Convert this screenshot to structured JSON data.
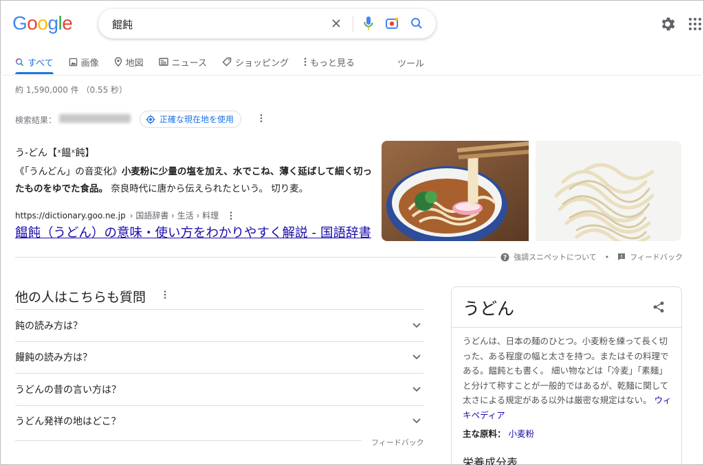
{
  "logo": {
    "letters": [
      "G",
      "o",
      "o",
      "g",
      "l",
      "e"
    ],
    "colors": [
      "#4285f4",
      "#ea4335",
      "#fbbc05",
      "#4285f4",
      "#34a853",
      "#ea4335"
    ]
  },
  "search": {
    "query": "餛飩"
  },
  "tabs": [
    {
      "label": "すべて",
      "icon": "search-icon"
    },
    {
      "label": "画像",
      "icon": "image-icon"
    },
    {
      "label": "地図",
      "icon": "map-pin-icon"
    },
    {
      "label": "ニュース",
      "icon": "news-icon"
    },
    {
      "label": "ショッピング",
      "icon": "tag-icon"
    },
    {
      "label": "もっと見る",
      "icon": "more-vert-icon"
    }
  ],
  "tools_label": "ツール",
  "stats": "約 1,590,000 件 （0.55 秒）",
  "location": {
    "label": "検索結果：",
    "button": "正確な現在地を使用"
  },
  "snippet": {
    "word": "う‐どん【ˣ饂ˣ飩】",
    "text_a": "《「うんどん」の音変化》",
    "text_b": "小麦粉に少量の塩を加え、水でこね、薄く延ばして細く切ったものをゆでた食品。",
    "text_c": " 奈良時代に唐から伝えられたという。 切り麦。",
    "url": "https://dictionary.goo.ne.jp",
    "crumbs": "› 国語辞書 › 生活 › 料理",
    "link": "饂飩（うどん）の意味・使い方をわかりやすく解説 - 国語辞書",
    "about": "強調スニペットについて",
    "sep": "•",
    "feedback": "フィードバック"
  },
  "paa": {
    "title": "他の人はこちらも質問",
    "questions": [
      "飩の読み方は？",
      "饅飩の読み方は？",
      "うどんの昔の言い方は？",
      "うどん発祥の地はどこ？"
    ],
    "feedback": "フィードバック"
  },
  "kp": {
    "title": "うどん",
    "desc": "うどんは、日本の麺のひとつ。小麦粉を練って長く切った、ある程度の幅と太さを持つ。またはその料理である。饂飩とも書く。 細い物などは「冷麦」「素麺」と分けて称すことが一般的ではあるが、乾麺に関して太さによる規定がある以外は厳密な規定はない。 ",
    "wiki": "ウィキペディア",
    "ingredient_label": "主な原料：",
    "ingredient": "小麦粉",
    "nutrition": "栄養成分表"
  }
}
